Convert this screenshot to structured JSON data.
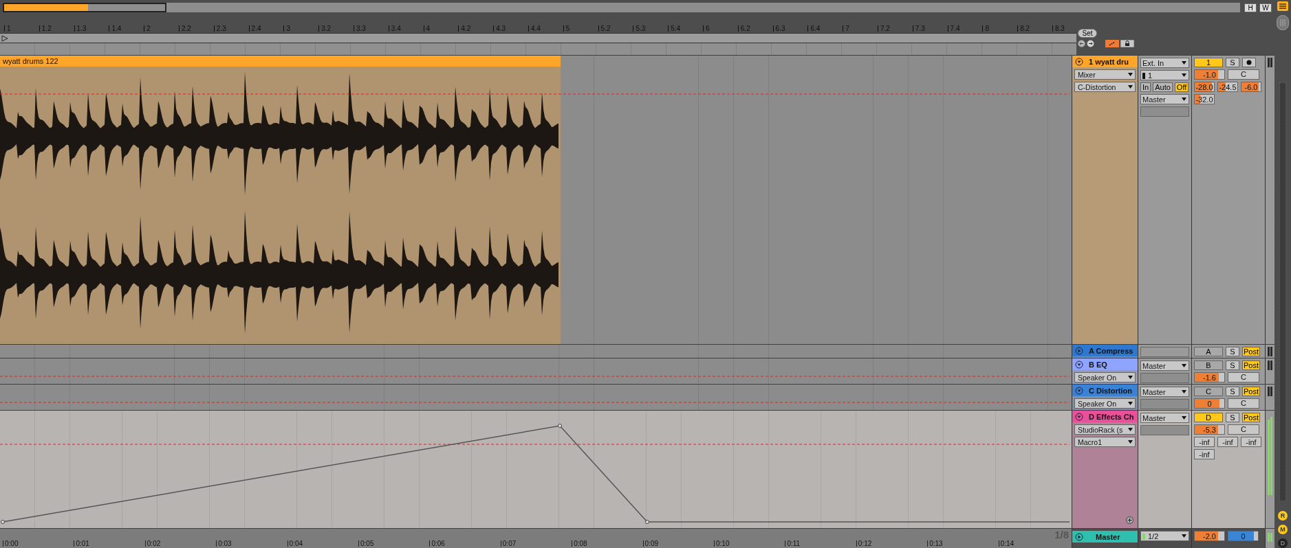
{
  "overview": {
    "toggles": [
      "H",
      "W"
    ]
  },
  "beat_ruler": {
    "labels": [
      "1",
      "1.2",
      "1.3",
      "1.4",
      "2",
      "2.2",
      "2.3",
      "2.4",
      "3",
      "3.2",
      "3.3",
      "3.4",
      "4",
      "4.2",
      "4.3",
      "4.4",
      "5",
      "5.2",
      "5.3",
      "5.4",
      "6",
      "6.2",
      "6.3",
      "6.4",
      "7",
      "7.2",
      "7.3",
      "7.4",
      "8",
      "8.2",
      "8.3"
    ]
  },
  "set_button": "Set",
  "tracks": [
    {
      "kind": "audio",
      "name": "1 wyatt dru",
      "color": "#ffa52a",
      "expanded": true,
      "envelope": false,
      "clip": {
        "name": "wyatt drums 122"
      },
      "devices": [
        "Mixer",
        "C-Distortion"
      ],
      "input_type": "Ext. In",
      "input_channel": "1",
      "monitor": [
        {
          "label": "In",
          "selected": false
        },
        {
          "label": "Auto",
          "selected": false
        },
        {
          "label": "Off",
          "selected": true
        }
      ],
      "output": "Master",
      "activator": {
        "label": "1",
        "on": true
      },
      "solo": "S",
      "volume": {
        "value": "-1.0",
        "level": 0.8
      },
      "pan": "C",
      "sends": [
        {
          "value": "-28.0",
          "level": 0.9
        },
        {
          "value": "-24.5",
          "level": 0.4
        },
        {
          "value": "-6.0",
          "level": 0.9
        },
        {
          "value": "-32.0",
          "level": 0.3
        }
      ]
    },
    {
      "kind": "return",
      "name": "A Compress",
      "color": "#2f78cf",
      "expanded": false,
      "envelope": false,
      "activator": {
        "label": "A",
        "on": false
      },
      "solo": "S",
      "post": "Post"
    },
    {
      "kind": "return",
      "name": "B EQ",
      "color": "#8ea4ff",
      "expanded": true,
      "envelope": false,
      "devices": [
        "Speaker On"
      ],
      "output": "Master",
      "activator": {
        "label": "B",
        "on": false
      },
      "solo": "S",
      "post": "Post",
      "volume": {
        "value": "-1.6",
        "level": 0.82
      },
      "pan": "C"
    },
    {
      "kind": "return",
      "name": "C Distortion",
      "color": "#3a82d6",
      "expanded": true,
      "envelope": false,
      "devices": [
        "Speaker On"
      ],
      "output": "Master",
      "activator": {
        "label": "C",
        "on": false
      },
      "solo": "S",
      "post": "Post",
      "volume": {
        "value": "0",
        "level": 0.83
      },
      "pan": "C"
    },
    {
      "kind": "return",
      "name": "D Effects Ch",
      "color": "#e8509a",
      "expanded": true,
      "envelope": true,
      "devices": [
        "StudioRack (s",
        "Macro1"
      ],
      "output": "Master",
      "activator": {
        "label": "D",
        "on": true
      },
      "solo": "S",
      "post": "Post",
      "volume": {
        "value": "-5.3",
        "level": 0.8
      },
      "pan": "C",
      "sends": [
        {
          "value": "-inf"
        },
        {
          "value": "-inf"
        },
        {
          "value": "-inf"
        },
        {
          "value": "-inf"
        }
      ]
    }
  ],
  "time_ruler": {
    "labels": [
      "0:00",
      "0:01",
      "0:02",
      "0:03",
      "0:04",
      "0:05",
      "0:06",
      "0:07",
      "0:08",
      "0:09",
      "0:10",
      "0:11",
      "0:12",
      "0:13",
      "0:14"
    ],
    "grid": "1/8"
  },
  "master": {
    "name": "Master",
    "color": "#2fbfae",
    "output": "1/2",
    "volume": {
      "value": "-2.0",
      "level": 0.8
    },
    "pan": {
      "value": "0",
      "level": 0.85
    }
  },
  "side_buttons": [
    {
      "label": "R",
      "on": true
    },
    {
      "label": "M",
      "on": true
    },
    {
      "label": "D",
      "on": false
    }
  ]
}
